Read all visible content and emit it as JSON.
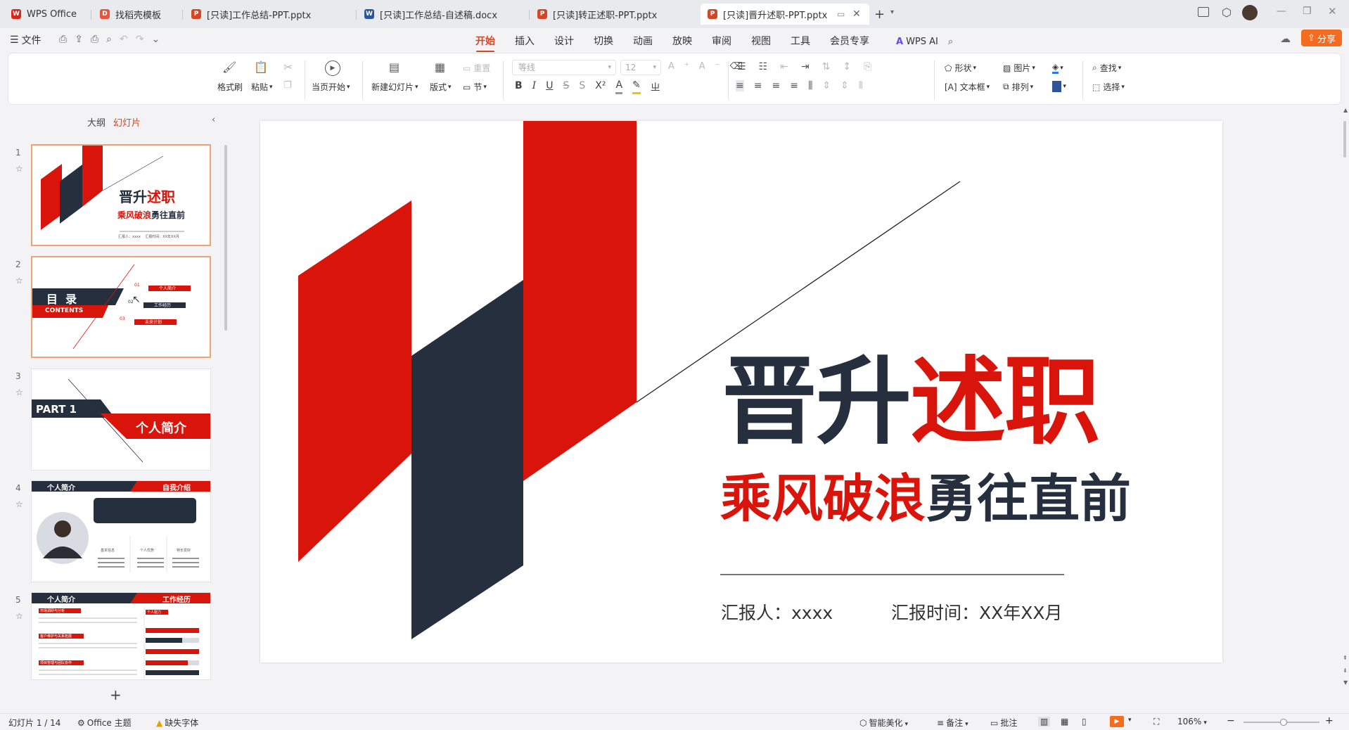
{
  "tabs": [
    {
      "label": "WPS Office",
      "icon": "wps-logo-icon",
      "color": "#d9261c"
    },
    {
      "label": "找稻壳模板",
      "icon": "docer-icon",
      "color": "#e8543c"
    },
    {
      "label": "[只读]工作总结-PPT.pptx",
      "icon": "ppt-file-icon",
      "color": "#d24726"
    },
    {
      "label": "[只读]工作总结-自述稿.docx",
      "icon": "docx-file-icon",
      "color": "#2b579a"
    },
    {
      "label": "[只读]转正述职-PPT.pptx",
      "icon": "ppt-file-icon",
      "color": "#d24726"
    },
    {
      "label": "[只读]晋升述职-PPT.pptx",
      "icon": "ppt-file-icon",
      "color": "#d24726"
    }
  ],
  "menu": {
    "file": "文件",
    "tabs": [
      "开始",
      "插入",
      "设计",
      "切换",
      "动画",
      "放映",
      "审阅",
      "视图",
      "工具",
      "会员专享"
    ],
    "wps_ai": "WPS AI",
    "share": "分享"
  },
  "ribbon": {
    "format_painter": "格式刷",
    "paste": "粘贴",
    "from_start": "当页开始",
    "new_slide": "新建幻灯片",
    "layout": "版式",
    "section": "节",
    "reset": "重置",
    "font_name": "等线",
    "font_size": "12",
    "shape": "形状",
    "picture": "图片",
    "textbox": "文本框",
    "arrange": "排列",
    "find": "查找",
    "select": "选择"
  },
  "panel": {
    "outline_tab": "大纲",
    "slides_tab": "幻灯片",
    "slides": [
      {
        "num": "1"
      },
      {
        "num": "2"
      },
      {
        "num": "3"
      },
      {
        "num": "4"
      },
      {
        "num": "5"
      }
    ]
  },
  "thumb1": {
    "title_a": "晋升",
    "title_b": "述职",
    "sub_a": "乘风破浪",
    "sub_b": "勇往直前",
    "meta": "汇报人：xxxx    汇报时间：XX年XX月"
  },
  "thumb2": {
    "mulu": "目  录",
    "contents": "CONTENTS",
    "n1": "01",
    "n2": "02",
    "n3": "03",
    "i1": "个人简介",
    "i2": "工作经历",
    "i3": "未来计划"
  },
  "thumb3": {
    "part": "PART 1",
    "title": "个人简介"
  },
  "thumb4": {
    "left": "个人简介",
    "right": "自我介绍",
    "c1": "基本信息",
    "c2": "个人优势",
    "c3": "特长爱好"
  },
  "thumb5": {
    "left": "个人简介",
    "right": "工作经历",
    "h1": "市场调研与分析",
    "h2": "客户维护与关系拓展",
    "h3": "项目管理与团队协作",
    "skill": "个人能力"
  },
  "slide": {
    "title_dark": "晋升",
    "title_red": "述职",
    "sub_red": "乘风破浪",
    "sub_dark": "勇往直前",
    "reporter": "汇报人：xxxx",
    "report_time": "汇报时间：XX年XX月"
  },
  "status": {
    "slide_count": "幻灯片 1 / 14",
    "theme": "Office 主题",
    "missing_font": "缺失字体",
    "beautify": "智能美化",
    "notes": "备注",
    "comments": "批注",
    "zoom": "106%"
  },
  "colors": {
    "red": "#d9150b",
    "navy": "#252f3e",
    "accent": "#d24726"
  }
}
